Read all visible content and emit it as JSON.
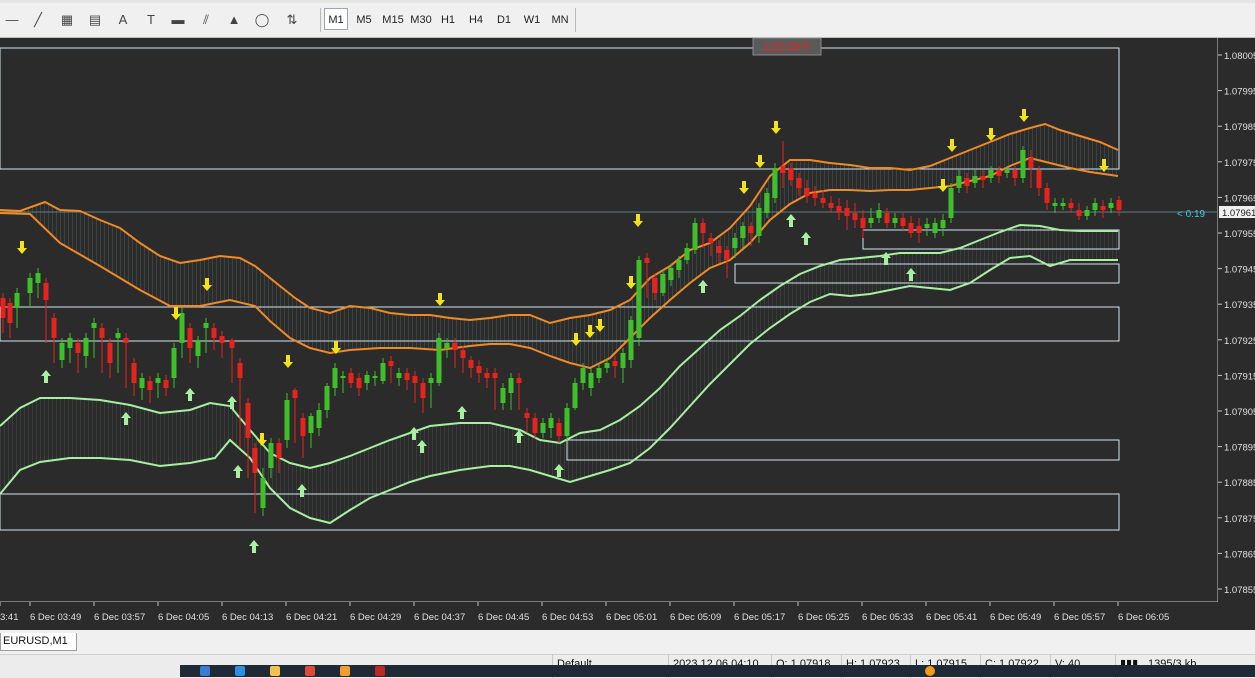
{
  "toolbar": {
    "tools": [
      "horizontal-line-icon",
      "trendline-icon",
      "fibonacci-fan-icon",
      "fibonacci-retracement-icon",
      "text-icon",
      "text-label-icon",
      "rectangle-icon",
      "channel-icon",
      "triangle-icon",
      "ellipse-icon",
      "arrows-dropdown-icon"
    ],
    "tool_glyphs": [
      "—",
      "╱",
      "▦",
      "▤",
      "A",
      "T",
      "▬",
      "⫽",
      "▲",
      "◯",
      "⇅"
    ],
    "timeframes": [
      "M1",
      "M5",
      "M15",
      "M30",
      "H1",
      "H4",
      "D1",
      "W1",
      "MN"
    ],
    "active_timeframe": "M1"
  },
  "chart": {
    "symbol_tab": "EURUSD,M1",
    "overlay_label": "123 OFF",
    "price_labels": [
      "1.08005",
      "1.07995",
      "1.07985",
      "1.07975",
      "1.07965",
      "1.07955",
      "1.07945",
      "1.07935",
      "1.07925",
      "1.07915",
      "1.07905",
      "1.07895",
      "1.07885",
      "1.07875",
      "1.07865",
      "1.07855"
    ],
    "current_price": "1.07961",
    "countdown": "< 0:19",
    "time_labels": [
      "3:41",
      "6 Dec 03:49",
      "6 Dec 03:57",
      "6 Dec 04:05",
      "6 Dec 04:13",
      "6 Dec 04:21",
      "6 Dec 04:29",
      "6 Dec 04:37",
      "6 Dec 04:45",
      "6 Dec 04:53",
      "6 Dec 05:01",
      "6 Dec 05:09",
      "6 Dec 05:17",
      "6 Dec 05:25",
      "6 Dec 05:33",
      "6 Dec 05:41",
      "6 Dec 05:49",
      "6 Dec 05:57",
      "6 Dec 06:05"
    ],
    "colors": {
      "background": "#2b2b2b",
      "bull": "#3fbf2a",
      "bear": "#e8221c",
      "orange_band": "#f08a24",
      "green_band": "#a6f0a0",
      "boxes": "#cfe7f0",
      "arrow_down": "#f2e21a",
      "arrow_up": "#a6f0a0"
    }
  },
  "status_bar": {
    "profile": "Default",
    "datetime": "2023.12.06 04:10",
    "open": "O: 1.07918",
    "high": "H: 1.07923",
    "low": "L: 1.07915",
    "close": "C: 1.07922",
    "volume": "V: 40",
    "traffic": "1395/3 kb"
  }
}
